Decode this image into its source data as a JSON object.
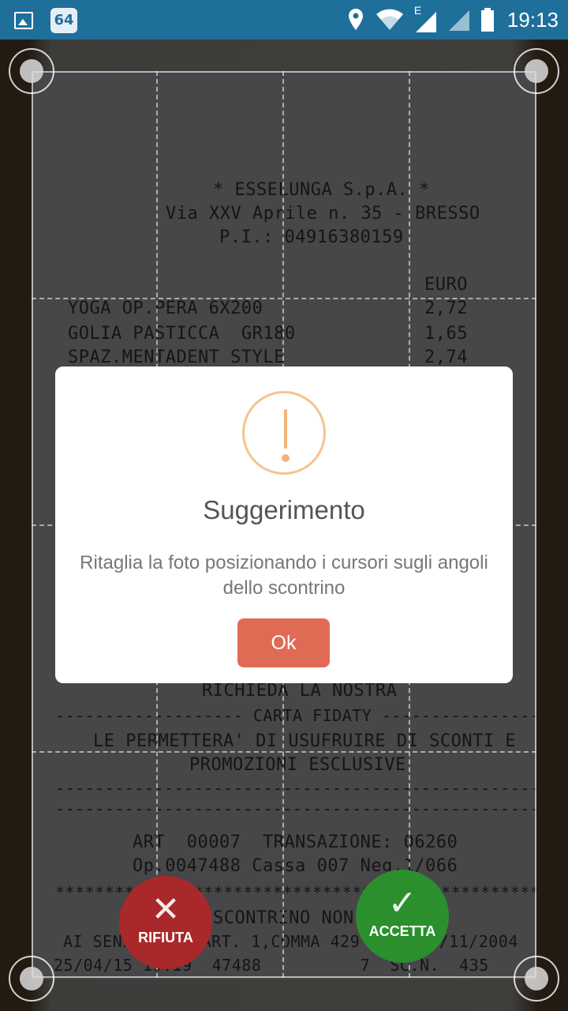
{
  "status_bar": {
    "notification_badge": "64",
    "network_type": "E",
    "time": "19:13",
    "icons": [
      "image-icon",
      "location-icon",
      "wifi-icon",
      "signal-icon",
      "battery-icon"
    ]
  },
  "receipt_lines": [
    "* ESSELUNGA S.p.A. *",
    "Via XXV Aprile n. 35 - BRESSO",
    "P.I.: 04916380159",
    "EURO",
    "YOGA OP.PERA 6X200",
    "2,72",
    "GOLIA PASTICCA  GR180",
    "1,65",
    "SPAZ.MENTADENT STYLE",
    "2,74",
    "RICHIEDA LA NOSTRA",
    "------------------- CARTA FIDATY ------------------",
    "LE PERMETTERA' DI USUFRUIRE DI SCONTI E",
    "PROMOZIONI ESCLUSIVE",
    "--------------------------------------------------",
    "--------------------------------------------------",
    "ART  00007  TRANSAZIONE: 06260",
    "Op.0047488 Cassa 007 Neg.1/066",
    "*************************************************",
    "SCONTRINO NON FISCALE",
    "AI SENSI DELL'ART. 1,COMMA 429  DEL 30/11/2004",
    "25/04/15 19:19  47488          7  SC.N.  435"
  ],
  "dialog": {
    "title": "Suggerimento",
    "message": "Ritaglia la foto posizionando i cursori sugli angoli dello scontrino",
    "ok_label": "Ok",
    "icon": "warning-icon"
  },
  "actions": {
    "reject_label": "RIFIUTA",
    "accept_label": "ACCETTA"
  },
  "colors": {
    "status_bar": "#1f6f9b",
    "warning": "#f5c38e",
    "ok_button": "#e06b55",
    "reject": "#a9282a",
    "accept": "#2b8f2e"
  }
}
